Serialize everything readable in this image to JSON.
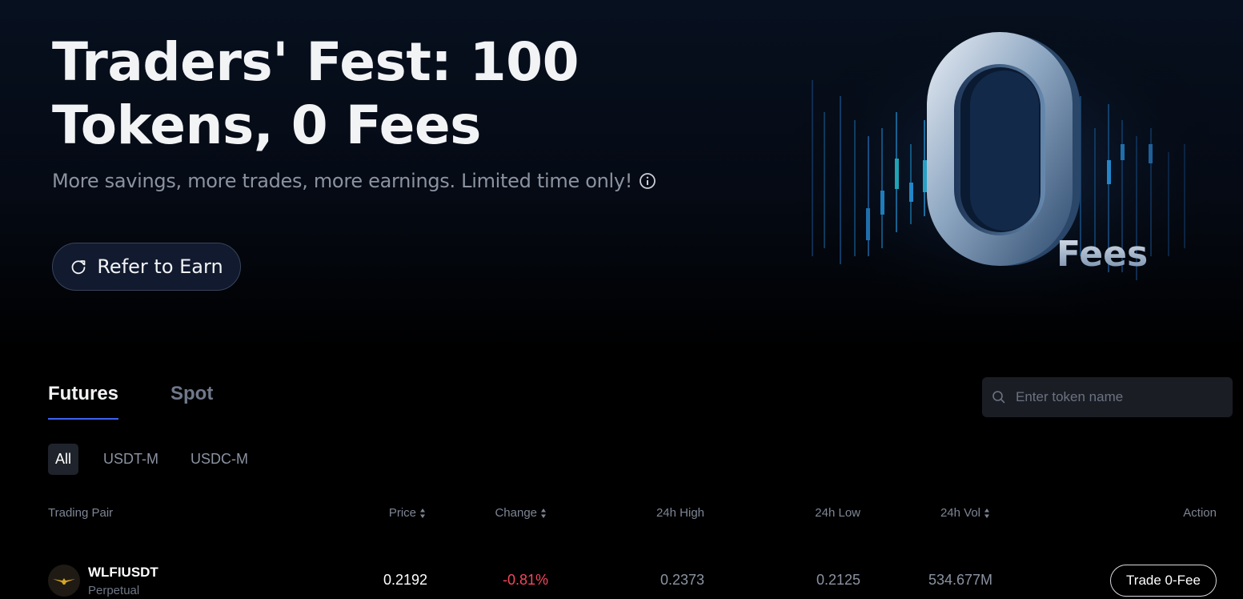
{
  "hero": {
    "title": "Traders' Fest: 100 Tokens, 0 Fees",
    "subtitle": "More savings, more trades, more earnings. Limited time only!",
    "refer_label": "Refer to Earn",
    "art_text": "Fees",
    "art_digit": "0"
  },
  "tabs": [
    {
      "label": "Futures",
      "active": true
    },
    {
      "label": "Spot",
      "active": false
    }
  ],
  "search": {
    "placeholder": "Enter token name"
  },
  "filters": [
    {
      "label": "All",
      "active": true
    },
    {
      "label": "USDT-M",
      "active": false
    },
    {
      "label": "USDC-M",
      "active": false
    }
  ],
  "table": {
    "headers": {
      "pair": "Trading Pair",
      "price": "Price",
      "change": "Change",
      "high": "24h High",
      "low": "24h Low",
      "vol": "24h Vol",
      "action": "Action"
    },
    "rows": [
      {
        "pair": "WLFIUSDT",
        "type": "Perpetual",
        "price": "0.2192",
        "change": "-0.81%",
        "high": "0.2373",
        "low": "0.2125",
        "vol": "534.677M",
        "action": "Trade 0-Fee"
      }
    ]
  },
  "colors": {
    "accent": "#3b63f3",
    "negative": "#f6465d",
    "background": "#000000"
  }
}
